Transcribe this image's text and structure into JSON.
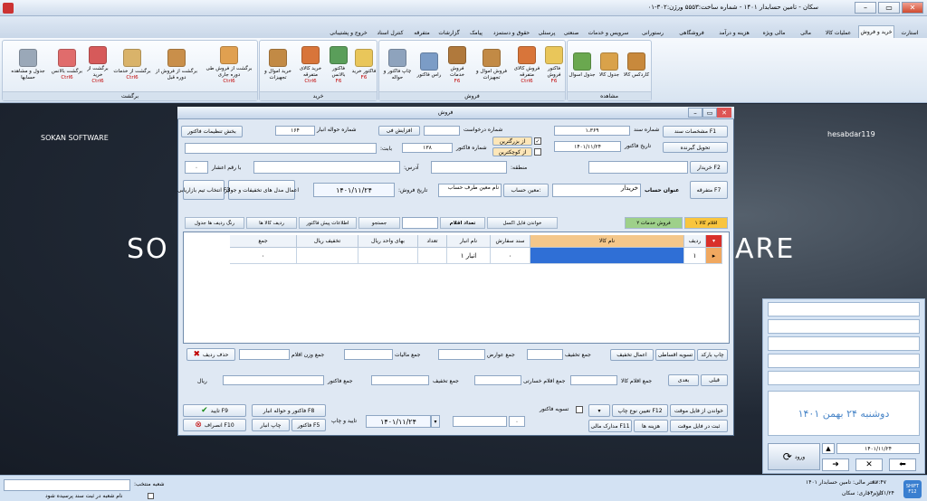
{
  "window": {
    "title": "سکان - تامین حسابدار ۱۴۰۱ - شماره ساخت:۵۵۵۳ ورژن:۳۰۲-۰۱"
  },
  "tabs": [
    {
      "label": "استارت"
    },
    {
      "label": "خرید و فروش"
    },
    {
      "label": "عملیات کالا"
    },
    {
      "label": "مالی"
    },
    {
      "label": "مالی ویژه"
    },
    {
      "label": "هزینه و درآمد"
    },
    {
      "label": "فروشگاهی"
    },
    {
      "label": "رستورانی"
    },
    {
      "label": "سرویس و خدمات"
    },
    {
      "label": "صنعتی"
    },
    {
      "label": "پرسنلی"
    },
    {
      "label": "حقوق و دستمزد"
    },
    {
      "label": "پیامک"
    },
    {
      "label": "گزارشات"
    },
    {
      "label": "متفرقه"
    },
    {
      "label": "کنترل اسناد"
    },
    {
      "label": "خروج و پشتیبانی"
    }
  ],
  "ribbon": {
    "groups": [
      {
        "label": "مشاهده"
      },
      {
        "label": "فروش"
      },
      {
        "label": "خرید"
      },
      {
        "label": "برگشت"
      }
    ],
    "buttons": [
      {
        "label": "کاردکس کالا",
        "key": ""
      },
      {
        "label": "جدول کالا",
        "key": ""
      },
      {
        "label": "جدول اسوال",
        "key": ""
      },
      {
        "label": "فاکتور فروش",
        "key": "F6"
      },
      {
        "label": "فروش کالای متفرقه",
        "key": "Ctrl6"
      },
      {
        "label": "فروش اموال و تجهیزات",
        "key": ""
      },
      {
        "label": "فروش خدمات",
        "key": "F6"
      },
      {
        "label": "راس فاکتور",
        "key": ""
      },
      {
        "label": "چاپ فاکتور و حواله",
        "key": ""
      },
      {
        "label": "فاکتور خرید",
        "key": "F6"
      },
      {
        "label": "فاکتور بالانس",
        "key": "F6"
      },
      {
        "label": "خرید کالای متفرقه",
        "key": "Ctrl6"
      },
      {
        "label": "خرید اموال و تجهیزات",
        "key": ""
      },
      {
        "label": "برگشت از فروش طی دوره جاری",
        "key": "Ctrl6"
      },
      {
        "label": "برگشت از فروش از دوره قبل",
        "key": ""
      },
      {
        "label": "برگشت از خدمات",
        "key": "Ctrl6"
      },
      {
        "label": "برگشت از خرید",
        "key": "Ctrl6"
      },
      {
        "label": "برگشت بالانس",
        "key": "Ctrl6"
      },
      {
        "label": "جدول و مشاهده حسابها",
        "key": ""
      }
    ]
  },
  "background": {
    "left_brand": "SOKAN SOFTWARE",
    "right_brand": "hesabdar119",
    "big_left": "SO",
    "big_right": "ARE"
  },
  "dialog": {
    "title": "فروش",
    "btn_doc_spec": "مشخصات سند F1",
    "btn_deliver": "تحویل گیرنده",
    "lbl_doc_no": "شماره سند",
    "val_doc_no": "۱،۳۶۹",
    "lbl_inv_date": "تاریخ فاکتور",
    "val_inv_date": "۱۴۰۱/۱۱/۲۴",
    "lbl_request_no": "شماره درخواست",
    "opt_large": "از بزرگترین",
    "opt_small": "از کوچکترین",
    "lbl_inv_no": "شماره فاکتور",
    "val_inv_no": "۱۳۸",
    "lbl_increase": "افزایش فی",
    "lbl_warehouse_no": "شماره حواله انبار",
    "val_warehouse_no": "۱۶۴",
    "btn_inv_settings": "بخش تنظیمات فاکتور",
    "lbl_babat": "بابت:",
    "lbl_buyer": "خریدار F2",
    "lbl_region": "منطقه:",
    "lbl_address": "آدرس:",
    "lbl_decimal": "با رقم اعشار",
    "val_decimal": "۰",
    "btn_misc": "متفرقه F7",
    "lbl_account_title": "عنوان حساب",
    "val_account_title": "خریدار",
    "btn_set_account": "معین حساب:",
    "val_set_account": "نام معین طرف حساب",
    "lbl_sale_date": "تاریخ فروش:",
    "val_sale_date": "۱۴۰۱/۱۱/۲۴",
    "btn_discounts": "اعمال مدل های تخفیفات و جوایز",
    "btn_visitor": "انتخاب تیم بازاریابی F3",
    "tab_items": "اقلام کالا ۱",
    "tab_services": "فروش خدمات ۲",
    "btn_read_file": "خواندن فایل اکسل",
    "lbl_item_count": "تعداد اقلام",
    "btn_search": "جستجو",
    "btn_cargo": "اطلاعات پیش فاکتور",
    "btn_rows": "ردیف کالا ها",
    "btn_row_color": "رنگ ردیف ها جدول",
    "grid_headers": [
      "ردیف",
      "نام کالا",
      "سند سفارش",
      "نام انبار",
      "تعداد",
      "بهای واحد ریال",
      "تخفیف ریال",
      "جمع"
    ],
    "grid_rows": [
      {
        "row": "۱",
        "name": "",
        "order": "۰",
        "warehouse": "انبار ۱",
        "qty": "",
        "price": "",
        "discount": "",
        "total": "۰"
      }
    ],
    "btn_barcode": "چاپ بارکد",
    "btn_settle": "تسویه اقساطی",
    "btn_apply_discount": "اعمال تخفیف",
    "lbl_sum_discount": "جمع تخفیف",
    "lbl_sum_fees": "جمع عوارض",
    "lbl_sum_tax": "جمع مالیات",
    "lbl_sum_weight": "جمع وزن اقلام",
    "btn_delete_row": "حذف ردیف",
    "btn_prev": "قبلی",
    "btn_next": "بعدی",
    "lbl_sum_items": "جمع اقلام کالا",
    "lbl_sum_damaged": "جمع اقلام خسارتی",
    "lbl_sum_discount2": "جمع تخفیف",
    "lbl_sum_invoice": "جمع فاکتور",
    "lbl_rial": "ریال",
    "btn_read_temp": "خواندن از فایل موقت",
    "btn_print_type": "تعیین نوع چاپ F12",
    "btn_save_temp": "ثبت در فایل موقت",
    "btn_costs": "هزینه ها",
    "btn_fin": "مدارک مالی F11",
    "lbl_settle": "تسویه فاکتور",
    "val_settle": "۰",
    "val_date_bottom": "۱۴۰۱/۱۱/۲۴",
    "lbl_confirm_print": "تایید و چاپ",
    "btn_invoice": "فاکتور F5",
    "btn_print_warehouse": "چاپ انبار",
    "btn_inv_wh": "فاکتور و حواله انبار F8",
    "btn_ok": "تایید F9",
    "btn_cancel": "انصراف F10"
  },
  "right_panel": {
    "date_text": "دوشنبه ۲۴ بهمن ۱۴۰۱",
    "date_val": "۱۴۰۱/۱۱/۲۴",
    "btn_label": "ورود"
  },
  "status": {
    "branch_label": "شعبه منتخب:",
    "check_label": "نام شعبه در ثبت سند پرسیده شود",
    "company": "دفتر مالی: تامین حسابدار ۱۴۰۱",
    "user": "کاربر جاری: سکان",
    "time": "۱۷:۴۷",
    "date": "۱۴۰۱/۱۱/۲۴",
    "shift": "SHIFT F12"
  },
  "colors": {
    "accent": "#e8930c",
    "brand": "#2a4d7b",
    "grid_selected": "#2f6fd6"
  }
}
